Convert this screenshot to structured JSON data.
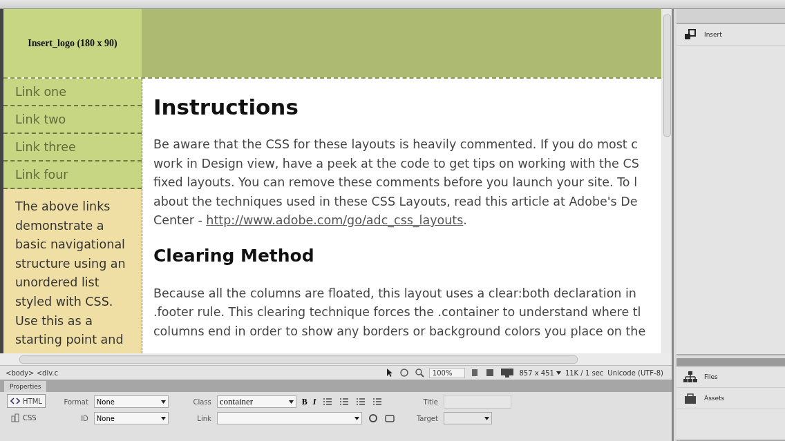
{
  "header": {
    "logo": "Insert_logo (180 x 90)"
  },
  "sidebar": {
    "links": [
      {
        "label": "Link one"
      },
      {
        "label": "Link two"
      },
      {
        "label": "Link three"
      },
      {
        "label": "Link four"
      }
    ],
    "note_lines": [
      "The above links",
      "demonstrate a",
      "basic navigational",
      "structure using an",
      "unordered list",
      "styled with CSS.",
      "Use this as a",
      "starting point and"
    ]
  },
  "content": {
    "sections": [
      {
        "heading": "Instructions",
        "lines": [
          "Be aware that the CSS for these layouts is heavily commented. If you do most c",
          "work in Design view, have a peek at the code to get tips on working with the CS",
          "fixed layouts. You can remove these comments before you launch your site. To l",
          "about the techniques used in these CSS Layouts, read this article at Adobe's De"
        ],
        "last_line": {
          "text": "Center - ",
          "link": "http://www.adobe.com/go/adc_css_layouts",
          "after": "."
        }
      },
      {
        "heading": "Clearing Method",
        "lines": [
          "Because all the columns are floated, this layout uses a clear:both declaration in",
          ".footer rule. This clearing technique forces the .container to understand where tl",
          "columns end in order to show any borders or background colors you place on the"
        ]
      }
    ]
  },
  "status_bar": {
    "tag_path": "<body> <div.c",
    "zoom": "100%",
    "size": "857 x 451",
    "download": "11K / 1 sec",
    "encoding": "Unicode (UTF-8)"
  },
  "properties": {
    "title": "Properties",
    "modes": [
      {
        "label": "HTML",
        "selected": true
      },
      {
        "label": "CSS",
        "selected": false
      }
    ],
    "format": "None",
    "id": "None",
    "class": "container",
    "title_label": "Title",
    "target_label": "Target",
    "format_label": "Format",
    "id_label": "ID",
    "class_label": "Class",
    "link_label": "Link",
    "bold": "B",
    "italic": "I"
  },
  "panels": [
    {
      "label": "Insert"
    },
    {
      "label": "Files"
    },
    {
      "label": "Assets"
    }
  ]
}
